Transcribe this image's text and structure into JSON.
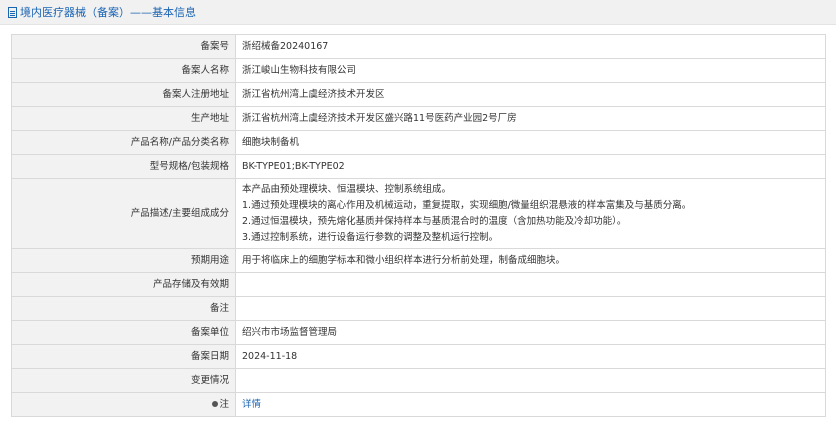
{
  "header": {
    "title": "境内医疗器械（备案）——基本信息",
    "icon": "document-icon"
  },
  "rows": [
    {
      "label": "备案号",
      "value": "浙绍械备20240167"
    },
    {
      "label": "备案人名称",
      "value": "浙江峻山生物科技有限公司"
    },
    {
      "label": "备案人注册地址",
      "value": "浙江省杭州湾上虞经济技术开发区"
    },
    {
      "label": "生产地址",
      "value": "浙江省杭州湾上虞经济技术开发区盛兴路11号医药产业园2号厂房"
    },
    {
      "label": "产品名称/产品分类名称",
      "value": "细胞块制备机"
    },
    {
      "label": "型号规格/包装规格",
      "value": "BK-TYPE01;BK-TYPE02"
    },
    {
      "label": "产品描述/主要组成成分",
      "lines": [
        "本产品由预处理模块、恒温模块、控制系统组成。",
        "1.通过预处理模块的离心作用及机械运动，重复提取，实现细胞/微量组织混悬液的样本富集及与基质分离。",
        "2.通过恒温模块，预先熔化基质并保持样本与基质混合时的温度（含加热功能及冷却功能）。",
        "3.通过控制系统，进行设备运行参数的调整及整机运行控制。"
      ]
    },
    {
      "label": "预期用途",
      "value": "用于将临床上的细胞学标本和微小组织样本进行分析前处理，制备成细胞块。"
    },
    {
      "label": "产品存储及有效期",
      "value": ""
    },
    {
      "label": "备注",
      "value": ""
    },
    {
      "label": "备案单位",
      "value": "绍兴市市场监督管理局"
    },
    {
      "label": "备案日期",
      "value": "2024-11-18"
    },
    {
      "label": "变更情况",
      "value": ""
    },
    {
      "label": "注",
      "icon": "pin-icon",
      "link": "详情"
    }
  ]
}
